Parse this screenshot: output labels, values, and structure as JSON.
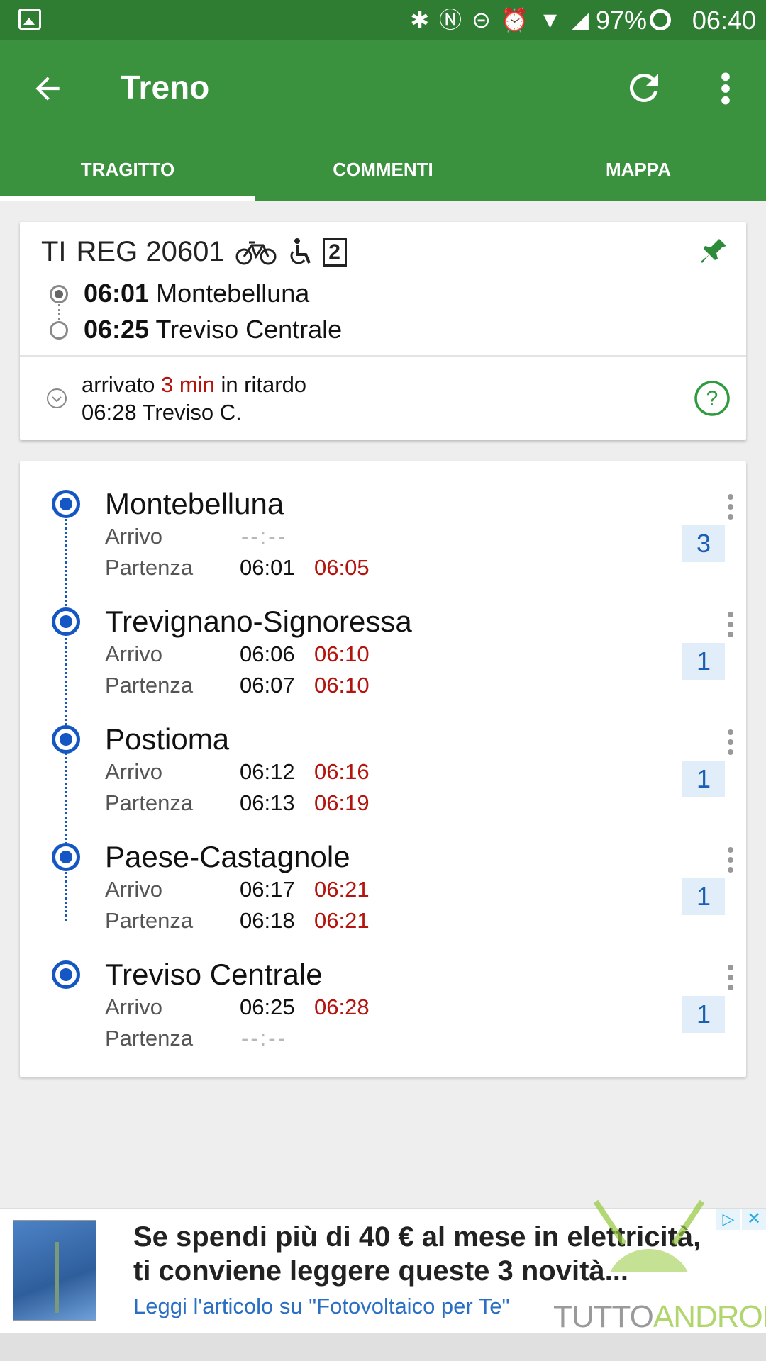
{
  "status_bar": {
    "battery": "97%",
    "time": "06:40"
  },
  "app_bar": {
    "title": "Treno"
  },
  "tabs": [
    {
      "label": "TRAGITTO",
      "selected": true
    },
    {
      "label": "COMMENTI",
      "selected": false
    },
    {
      "label": "MAPPA",
      "selected": false
    }
  ],
  "summary": {
    "train_type": "TI",
    "train_id": "REG 20601",
    "class_badge": "2",
    "origin": {
      "time": "06:01",
      "station": "Montebelluna"
    },
    "destination": {
      "time": "06:25",
      "station": "Treviso Centrale"
    },
    "status_prefix": "arrivato",
    "delay": "3 min",
    "status_suffix": "in ritardo",
    "arrival_line": "06:28 Treviso C."
  },
  "stop_labels": {
    "arrival": "Arrivo",
    "departure": "Partenza"
  },
  "stops": [
    {
      "name": "Montebelluna",
      "arr_sched": "--:--",
      "arr_real": "",
      "dep_sched": "06:01",
      "dep_real": "06:05",
      "platform": "3"
    },
    {
      "name": "Trevignano-Signoressa",
      "arr_sched": "06:06",
      "arr_real": "06:10",
      "dep_sched": "06:07",
      "dep_real": "06:10",
      "platform": "1"
    },
    {
      "name": "Postioma",
      "arr_sched": "06:12",
      "arr_real": "06:16",
      "dep_sched": "06:13",
      "dep_real": "06:19",
      "platform": "1"
    },
    {
      "name": "Paese-Castagnole",
      "arr_sched": "06:17",
      "arr_real": "06:21",
      "dep_sched": "06:18",
      "dep_real": "06:21",
      "platform": "1"
    },
    {
      "name": "Treviso Centrale",
      "arr_sched": "06:25",
      "arr_real": "06:28",
      "dep_sched": "--:--",
      "dep_real": "",
      "platform": "1"
    }
  ],
  "ad": {
    "line1": "Se spendi più di 40 € al mese in elettricità,",
    "line2": "ti conviene leggere queste 3 novità...",
    "line3": "Leggi l'articolo su \"Fotovoltaico per Te\"",
    "watermark_a": "TUTTO",
    "watermark_b": "ANDROID"
  },
  "colors": {
    "status_bar": "#2e7d32",
    "app_bar": "#3a913e",
    "delay_red": "#b3140e",
    "stop_blue": "#1457c4"
  }
}
